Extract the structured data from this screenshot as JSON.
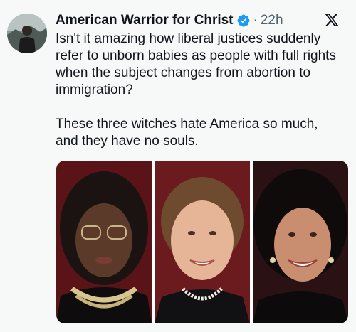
{
  "tweet": {
    "author_name": "American Warrior for Christ",
    "separator": "·",
    "time": "22h",
    "paragraphs": [
      "Isn't it amazing how liberal justices suddenly refer to unborn babies as people with full rights when the subject changes from abortion to immigration?",
      "These three witches hate America so much, and they have no souls."
    ],
    "media": {
      "photo_count": 3
    }
  },
  "icons": {
    "verified": "verified-badge-icon",
    "platform": "x-logo-icon"
  },
  "colors": {
    "verified": "#1d9bf0",
    "text": "#0f1419",
    "secondary": "#536471",
    "background": "#f7f8f8"
  }
}
